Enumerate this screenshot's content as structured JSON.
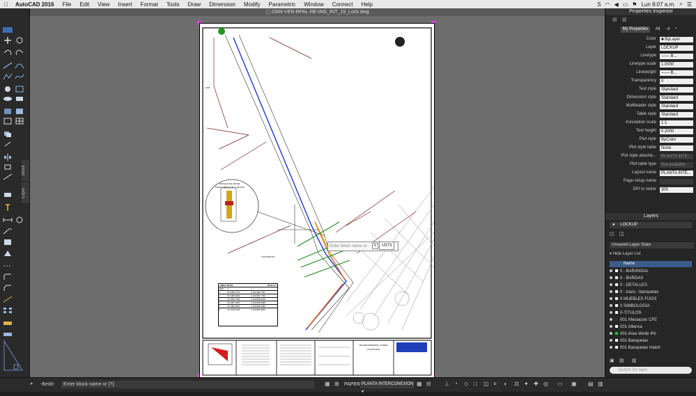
{
  "menubar": {
    "app_name": "AutoCAD 2016",
    "items": [
      "File",
      "Edit",
      "View",
      "Insert",
      "Format",
      "Tools",
      "Draw",
      "Dimension",
      "Modify",
      "Parametric",
      "Window",
      "Connect",
      "Help"
    ],
    "clock": "Lun 9:07 a.m."
  },
  "document": {
    "title": "ONN-VER-RPAL-RE-ING_INT_19_Lock.dwg"
  },
  "side_tabs": {
    "block": "Block",
    "explode": "Explo"
  },
  "drawing": {
    "labels": {
      "avai": "AVAI",
      "lote_baldio": "LOTE BALDIO",
      "detalle_title": "DETALLE DE CRUZE",
      "detalle_sub": "PARA TUBERIA DE 2\" DE PVC"
    },
    "table": {
      "title": "AREA TOTAL",
      "title_value": "65.31 m²",
      "headers": [
        "VERT",
        "X",
        "Y"
      ],
      "rows": [
        [
          "1",
          "701,866.3770",
          "2,160,908.7787"
        ],
        [
          "2",
          "701,880.5690",
          "2,160,887.7780"
        ],
        [
          "3",
          "701,883.7685",
          "2,160,896.8248"
        ],
        [
          "4",
          "701,857.3687",
          "2,160,808.8096"
        ],
        [
          "5",
          "701,882.2891",
          "2,160,888.6680"
        ],
        [
          "6",
          "701,878.9446",
          "2,160,887.8855"
        ]
      ]
    },
    "titleblock": {
      "project": "TRANSFORMADOR Y PARED",
      "company": "LOS PALMAS"
    }
  },
  "block_prompt": {
    "placeholder": "Enter block name or",
    "value": "U373"
  },
  "properties": {
    "title": "Properties Inspector",
    "tab_my": "My Properties",
    "tab_all": "All",
    "rows": [
      {
        "label": "Color",
        "value": "■ ByLayer"
      },
      {
        "label": "Layer",
        "value": "LOCKUP"
      },
      {
        "label": "Linetype",
        "value": "—— B..."
      },
      {
        "label": "Linetype scale",
        "value": "1.0000"
      },
      {
        "label": "Lineweight",
        "value": "—— B..."
      },
      {
        "label": "Transparency",
        "value": "0"
      },
      {
        "label": "Text style",
        "value": "Standard"
      },
      {
        "label": "Dimension style",
        "value": "Standard"
      },
      {
        "label": "Multileader style",
        "value": "Standard"
      },
      {
        "label": "Table style",
        "value": "Standard"
      },
      {
        "label": "Annotation scale",
        "value": "1:1"
      },
      {
        "label": "Text height",
        "value": "0.2000"
      },
      {
        "label": "Plot style",
        "value": "ByColor"
      },
      {
        "label": "Plot style table",
        "value": "None"
      },
      {
        "label": "Plot style attache...",
        "value": "PLANTA INTE..."
      },
      {
        "label": "Plot table type",
        "value": "Not available"
      },
      {
        "label": "Layout name",
        "value": "PLANTA INTE..."
      },
      {
        "label": "Page setup name",
        "value": ""
      },
      {
        "label": "DPI to raster",
        "value": "300"
      }
    ]
  },
  "layers": {
    "title": "Layers",
    "current": "LOCKUP",
    "state": "Unsaved Layer State",
    "hide_list": "Hide Layer List",
    "name_header": "Name",
    "items": [
      "0 - BARANDAL",
      "0 - BARDAS",
      "0 - DETALLES",
      "0 - trazo - banquetas",
      "0 MUEBLES FIJOS",
      "0 SIMBOLOGIA",
      "0-TITULOS",
      "001 Afectacion CFE",
      "001 Alberca",
      "001 Area Verde 4%",
      "001 Banquetas",
      "001 Banquetas Hatch"
    ],
    "search_placeholder": "Search for layer"
  },
  "status": {
    "bedit": "-Bedit:",
    "command": "Enter block name or [?]:",
    "paper": "PAPER",
    "layout": "PLANTA INTERCONEXION"
  }
}
